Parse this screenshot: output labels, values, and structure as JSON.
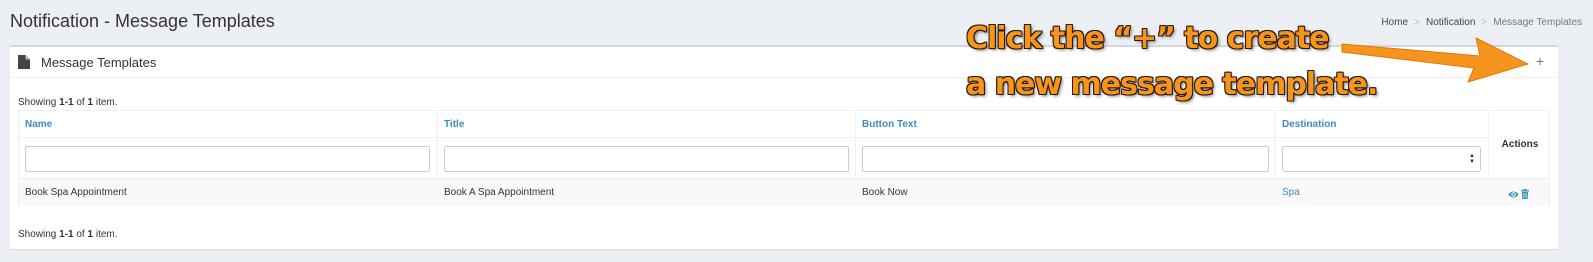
{
  "page": {
    "title": "Notification - Message Templates"
  },
  "breadcrumb": {
    "items": [
      "Home",
      "Notification",
      "Message Templates"
    ],
    "separator": ">"
  },
  "box": {
    "title": "Message Templates",
    "icon": "file-icon",
    "add_label": "+"
  },
  "summary": {
    "prefix": "Showing ",
    "range": "1-1",
    "middle": " of ",
    "total": "1",
    "suffix": " item."
  },
  "grid": {
    "columns": [
      {
        "label": "Name"
      },
      {
        "label": "Title"
      },
      {
        "label": "Button Text"
      },
      {
        "label": "Destination"
      }
    ],
    "actions_label": "Actions",
    "filters": {
      "name": "",
      "title": "",
      "button_text": "",
      "destination": ""
    },
    "rows": [
      {
        "name": "Book Spa Appointment",
        "title": "Book A Spa Appointment",
        "button_text": "Book Now",
        "destination": "Spa",
        "actions": [
          "eye-icon",
          "trash-icon"
        ]
      }
    ]
  },
  "annotation": {
    "line1": "Click the “+” to create",
    "line2": "a new message template."
  },
  "colors": {
    "link": "#3c8dbc",
    "annotation": "#f7941e",
    "background": "#ecf0f5"
  }
}
